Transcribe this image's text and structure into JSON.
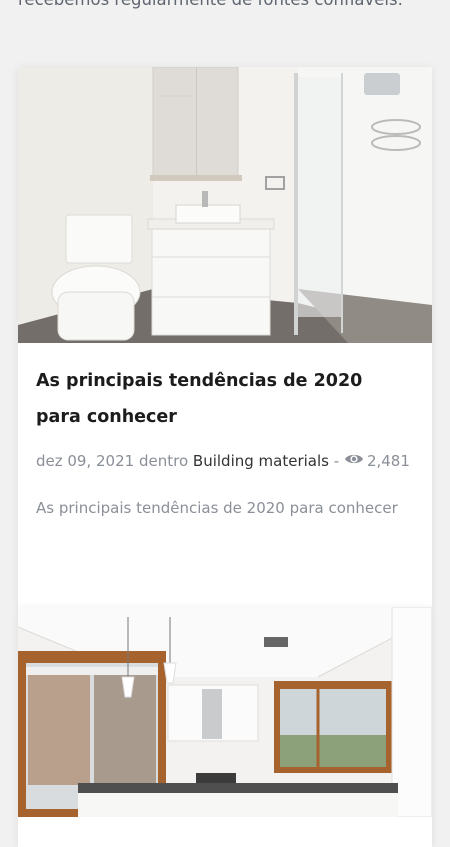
{
  "intro": {
    "text": "recebemos regularmente de fontes confiáveis."
  },
  "posts": [
    {
      "title": "As principais tendências de 2020 para conhecer",
      "date": "dez 09, 2021",
      "in_label": "dentro",
      "category": "Building materials",
      "separator": "-",
      "views": "2,481",
      "excerpt": "As principais tendências de 2020 para conhecer"
    }
  ],
  "icons": {
    "views": "eye-icon"
  }
}
